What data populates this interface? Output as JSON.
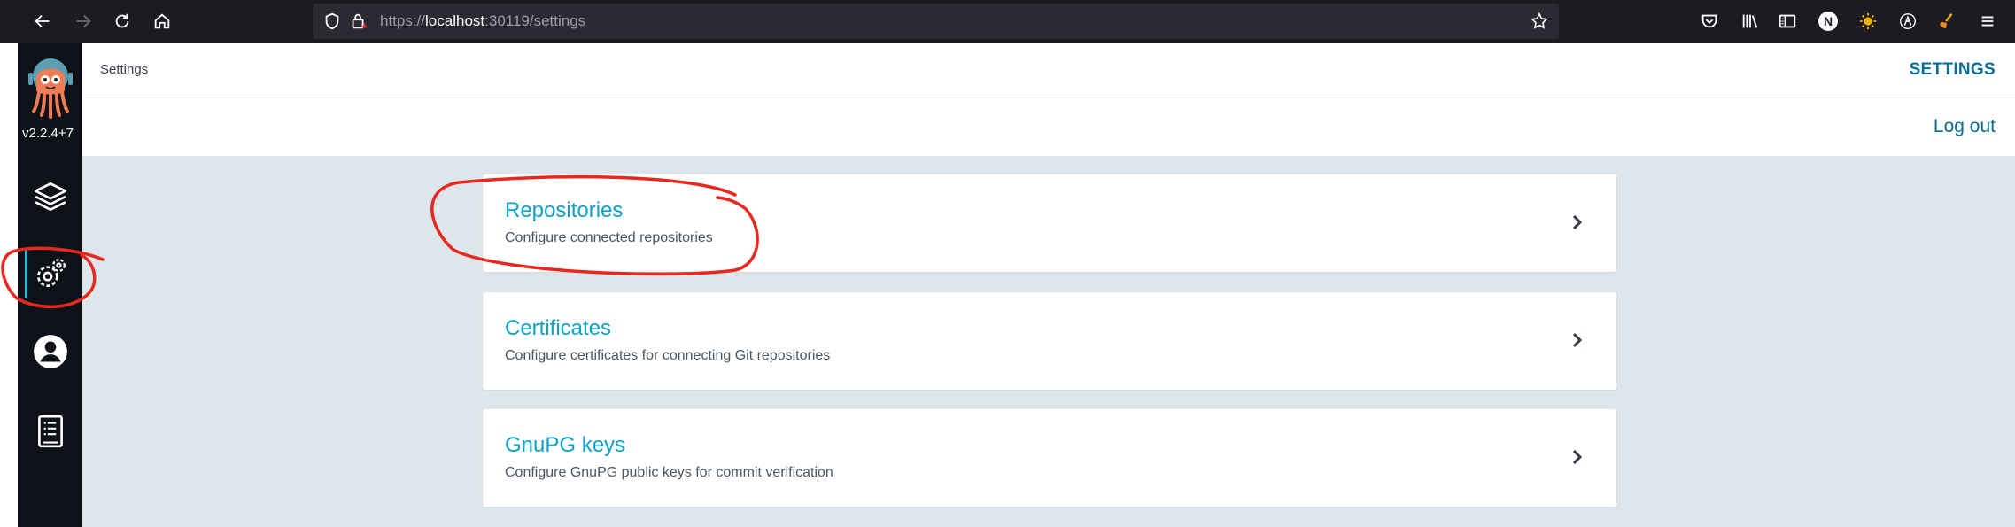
{
  "browser": {
    "url_scheme": "https://",
    "url_host": "localhost",
    "url_rest": ":30119/settings",
    "back_icon": "arrow-left-icon",
    "forward_icon": "arrow-right-icon",
    "reload_icon": "reload-icon",
    "home_icon": "home-icon",
    "profile_initial": "N"
  },
  "app": {
    "version": "v2.2.4+7",
    "sidebar": [
      {
        "name": "applications",
        "icon": "layers-icon"
      },
      {
        "name": "settings",
        "icon": "gears-icon",
        "active": true
      },
      {
        "name": "user-info",
        "icon": "user-circle-icon"
      },
      {
        "name": "documentation",
        "icon": "book-icon"
      }
    ]
  },
  "header": {
    "title": "Settings",
    "settings_label": "SETTINGS",
    "logout_label": "Log out"
  },
  "cards": [
    {
      "title": "Repositories",
      "description": "Configure connected repositories"
    },
    {
      "title": "Certificates",
      "description": "Configure certificates for connecting Git repositories"
    },
    {
      "title": "GnuPG keys",
      "description": "Configure GnuPG public keys for commit verification"
    }
  ],
  "colors": {
    "accent": "#0da3c9",
    "link": "#0a6d93",
    "sidebar": "#0e1117",
    "content_bg": "#dee6eb",
    "annotation": "#e8281e"
  }
}
